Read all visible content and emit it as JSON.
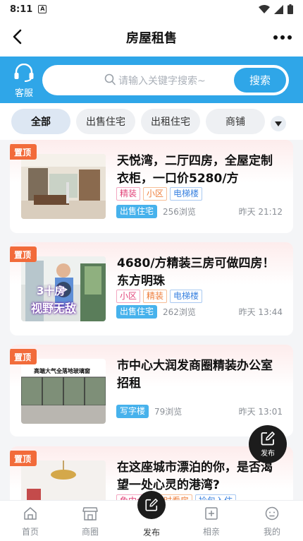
{
  "status": {
    "time": "8:11",
    "notif_icon": "A"
  },
  "header": {
    "title": "房屋租售"
  },
  "search": {
    "service_label": "客服",
    "placeholder": "请输入关键字搜索~",
    "button": "搜索"
  },
  "tabs": [
    {
      "label": "全部"
    },
    {
      "label": "出售住宅"
    },
    {
      "label": "出租住宅"
    },
    {
      "label": "商铺"
    }
  ],
  "listings": [
    {
      "pin": "置顶",
      "title": "天悦湾，二厅四房，全屋定制衣柜，一口价5280/方",
      "tags": [
        "精装",
        "小区",
        "电梯楼"
      ],
      "type": "出售住宅",
      "views": "256浏览",
      "time": "昨天 21:12"
    },
    {
      "pin": "置顶",
      "title": "4680/方精装三房可做四房！东方明珠",
      "tags": [
        "小区",
        "精装",
        "电梯楼"
      ],
      "type": "出售住宅",
      "views": "262浏览",
      "time": "昨天 13:44",
      "thumb_caption_1": "3十房",
      "thumb_caption_2": "视野无敌"
    },
    {
      "pin": "置顶",
      "title": "市中心大润发商圈精装办公室招租",
      "type": "写字楼",
      "views": "79浏览",
      "time": "昨天 13:01",
      "thumb_caption_1": "高端大气全落地玻璃窗"
    },
    {
      "pin": "置顶",
      "title": "在这座城市漂泊的你，是否渴望一处心灵的港湾?",
      "tags": [
        "免中介",
        "随时看房",
        "拎包入住"
      ]
    }
  ],
  "fab": {
    "label": "发布"
  },
  "nav": [
    {
      "label": "首页"
    },
    {
      "label": "商圈"
    },
    {
      "label": "发布"
    },
    {
      "label": "相亲"
    },
    {
      "label": "我的"
    }
  ],
  "colors": {
    "accent": "#2fa6e8",
    "pin": "#f26b3a",
    "type_badge": "#47b2ec"
  }
}
